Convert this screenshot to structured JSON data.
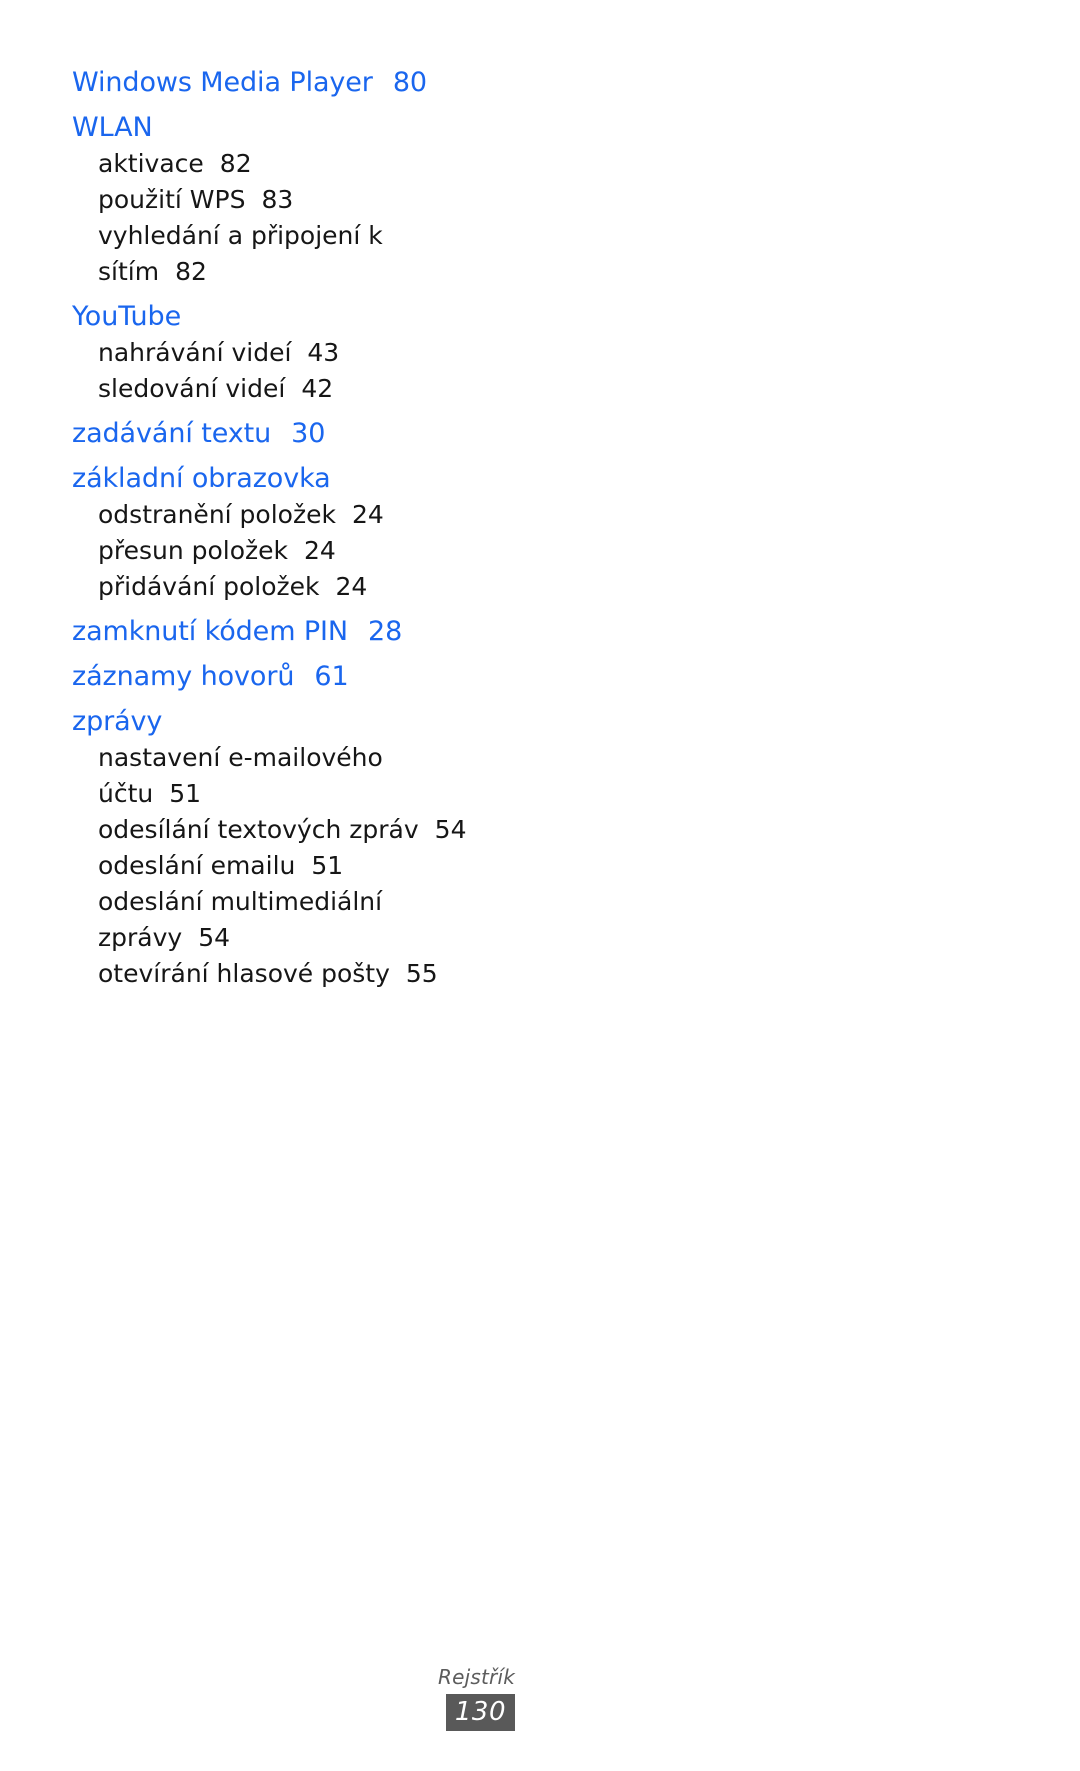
{
  "document": {
    "language": "cs",
    "page_label": "130",
    "section_label": "Rejstřík"
  },
  "colors": {
    "heading": "#1a66ee",
    "body": "#161616",
    "footer_label": "#5c5c5c",
    "footer_box": "#595959",
    "footer_box_text": "#ffffff",
    "background": "#ffffff"
  },
  "index": {
    "groups": [
      {
        "heading": "Windows Media Player",
        "heading_page": "80",
        "entries": []
      },
      {
        "heading": "WLAN",
        "heading_page": "",
        "entries": [
          {
            "text": "aktivace",
            "page": "82"
          },
          {
            "text": "použití WPS",
            "page": "83"
          },
          {
            "text": "vyhledání a připojení k sítím",
            "page": "82"
          }
        ]
      },
      {
        "heading": "YouTube",
        "heading_page": "",
        "entries": [
          {
            "text": "nahrávání videí",
            "page": "43"
          },
          {
            "text": "sledování videí",
            "page": "42"
          }
        ]
      },
      {
        "heading": "zadávání textu",
        "heading_page": "30",
        "entries": []
      },
      {
        "heading": "základní obrazovka",
        "heading_page": "",
        "entries": [
          {
            "text": "odstranění položek",
            "page": "24"
          },
          {
            "text": "přesun položek",
            "page": "24"
          },
          {
            "text": "přidávání položek",
            "page": "24"
          }
        ]
      },
      {
        "heading": "zamknutí kódem PIN",
        "heading_page": "28",
        "entries": []
      },
      {
        "heading": "záznamy hovorů",
        "heading_page": "61",
        "entries": []
      },
      {
        "heading": "zprávy",
        "heading_page": "",
        "entries": [
          {
            "text": "nastavení e-mailového účtu",
            "page": "51"
          },
          {
            "text": "odesílání textových zpráv",
            "page": "54"
          },
          {
            "text": "odeslání emailu",
            "page": "51"
          },
          {
            "text": "odeslání multimediální zprávy",
            "page": "54"
          },
          {
            "text": "otevírání hlasové pošty",
            "page": "55"
          }
        ]
      }
    ]
  }
}
